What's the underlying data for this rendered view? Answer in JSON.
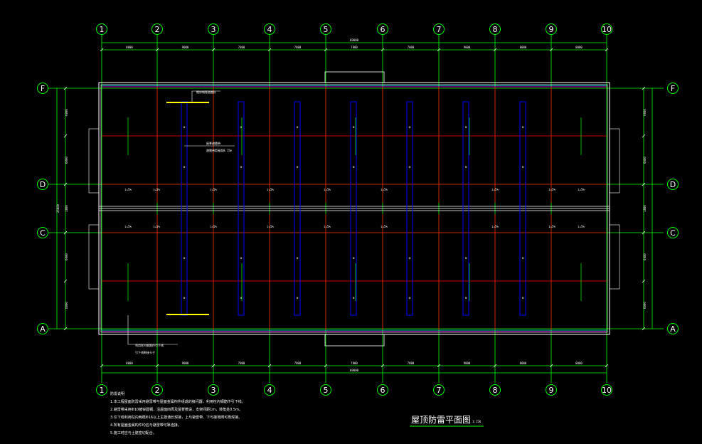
{
  "drawing": {
    "title": "屋顶防雷平面图",
    "scale": "1:150",
    "notes_heading": "防雷说明",
    "notes": [
      "1.本工程屋面防雷采用避雷带与屋面金属构件组成的接闪器，利用柱内钢筋作引下线。",
      "2.避雷带采用Φ10镀锌圆钢，沿屋面四周及屋脊敷设，支架间距1m，转角处0.5m。",
      "3.引下线利用柱内两根Φ16以上主筋通长焊接，上与避雷带、下与接地网可靠焊接。",
      "4.所有屋面金属构件均应与避雷带可靠连接。",
      "5.施工时应与土建密切配合。"
    ],
    "leader_notes": [
      "镀锌钢管避雷针",
      "屋脊避雷带",
      "避雷带距屋面0.15m",
      "利用柱内钢筋作引下线",
      "引下线断接卡子"
    ]
  },
  "axes": {
    "columns": [
      "1",
      "2",
      "3",
      "4",
      "5",
      "6",
      "7",
      "8",
      "9",
      "10"
    ],
    "rows": [
      "F",
      "D",
      "C",
      "A"
    ]
  },
  "dimensions": {
    "top_bays": [
      "8000",
      "9000",
      "7800",
      "7800",
      "7800",
      "7800",
      "9000",
      "8000",
      "8000"
    ],
    "top_total": "69000",
    "bottom_bays": [
      "8000",
      "9000",
      "7800",
      "7800",
      "7800",
      "7800",
      "9000",
      "8000",
      "8000"
    ],
    "bottom_total": "69000",
    "left_bays": [
      "6000",
      "6000",
      "1800",
      "6000",
      "6000"
    ],
    "left_total": "25800",
    "right_bays": [
      "6000",
      "6000",
      "1800",
      "6000",
      "6000"
    ]
  },
  "slope_labels": [
    "i=5%",
    "i=5%",
    "i=5%",
    "i=5%",
    "i=5%",
    "i=5%",
    "i=5%",
    "i=5%",
    "i=5%"
  ],
  "colors": {
    "background": "#000000",
    "axis_green": "#00ff00",
    "wall_white": "#ffffff",
    "red_line": "#ff0000",
    "blue_line": "#0000ff",
    "yellow_line": "#ffff00",
    "cyan": "#00ffff",
    "magenta": "#ff00ff"
  }
}
